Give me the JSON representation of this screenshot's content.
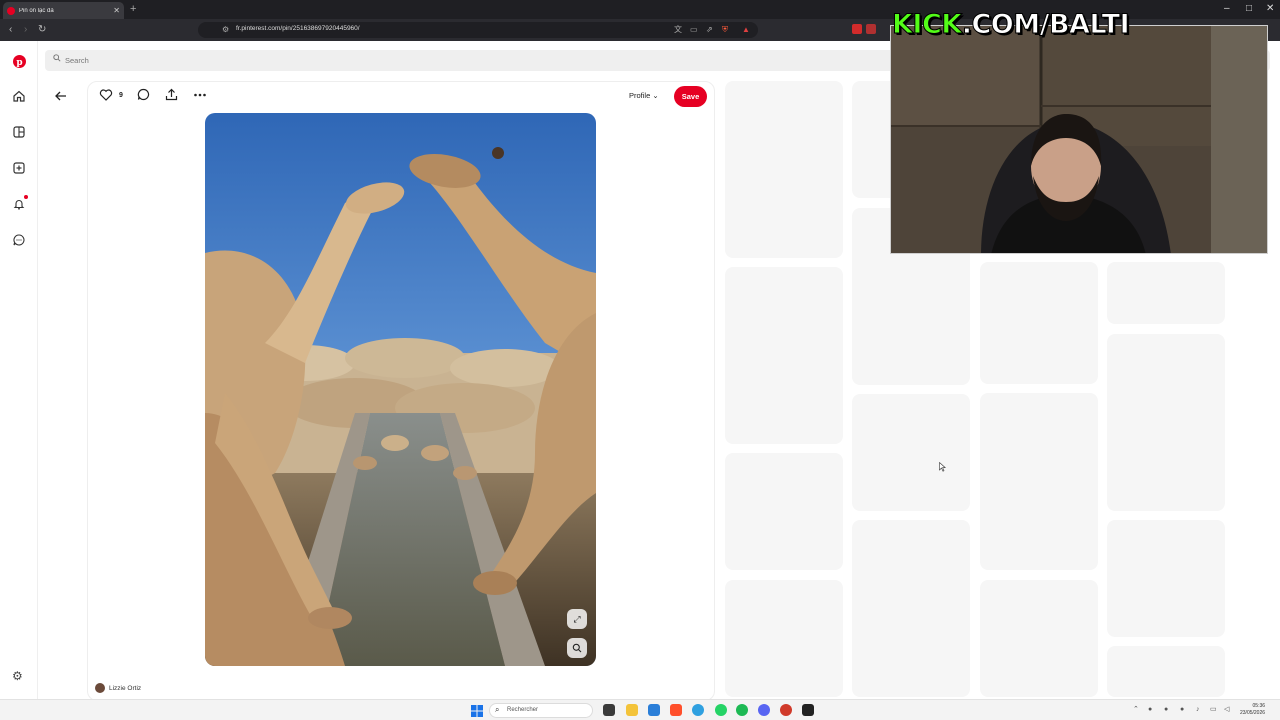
{
  "browser": {
    "tab_title": "Pin on lạc đà",
    "url": "fr.pinterest.com/pin/251638697920445960/"
  },
  "search": {
    "placeholder": "Search"
  },
  "pin": {
    "like_count": "9",
    "profile_label": "Profile",
    "save_label": "Save",
    "author": "Lizzie Ortiz"
  },
  "overlay": {
    "kick_brand": "KICK",
    "kick_rest": ".COM/BALTI"
  },
  "taskbar": {
    "search_placeholder": "Rechercher",
    "time": "05:36",
    "date": "23/05/2026"
  },
  "colors": {
    "pinterest_red": "#e60023",
    "kick_green": "#53fc18"
  }
}
